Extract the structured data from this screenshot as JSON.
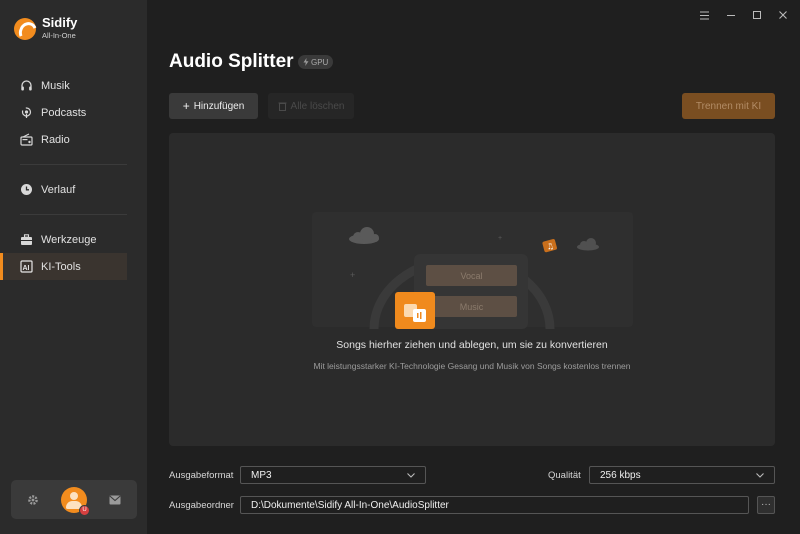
{
  "app": {
    "name": "Sidify",
    "subtitle": "All-In-One"
  },
  "sidebar": {
    "items": [
      {
        "label": "Musik",
        "icon": "headphones-icon"
      },
      {
        "label": "Podcasts",
        "icon": "podcast-icon"
      },
      {
        "label": "Radio",
        "icon": "radio-icon"
      },
      {
        "label": "Verlauf",
        "icon": "clock-icon"
      },
      {
        "label": "Werkzeuge",
        "icon": "toolbox-icon"
      },
      {
        "label": "KI-Tools",
        "icon": "ai-icon",
        "active": true
      }
    ],
    "bottom": {
      "settings_icon": "gear-icon",
      "avatar_icon": "avatar",
      "mail_icon": "mail-icon",
      "badge": "U"
    }
  },
  "window_controls": [
    "menu-icon",
    "minimize-icon",
    "maximize-icon",
    "close-icon"
  ],
  "page": {
    "title": "Audio Splitter",
    "gpu_badge": "GPU"
  },
  "toolbar": {
    "add_label": "Hinzufügen",
    "delete_all_label": "Alle löschen",
    "split_label": "Trennen mit KI"
  },
  "dropzone": {
    "vocal_label": "Vocal",
    "music_label": "Music",
    "title": "Songs hierher ziehen und ablegen, um sie zu konvertieren",
    "subtitle": "Mit leistungsstarker KI-Technologie Gesang und Musik von Songs kostenlos trennen"
  },
  "settings": {
    "format_label": "Ausgabeformat",
    "format_value": "MP3",
    "quality_label": "Qualität",
    "quality_value": "256 kbps",
    "folder_label": "Ausgabeordner",
    "folder_value": "D:\\Dokumente\\Sidify All-In-One\\AudioSplitter",
    "more_label": "···"
  },
  "colors": {
    "accent": "#f28c1e",
    "bg": "#1f1f1f",
    "sidebar": "#2b2b2b"
  }
}
